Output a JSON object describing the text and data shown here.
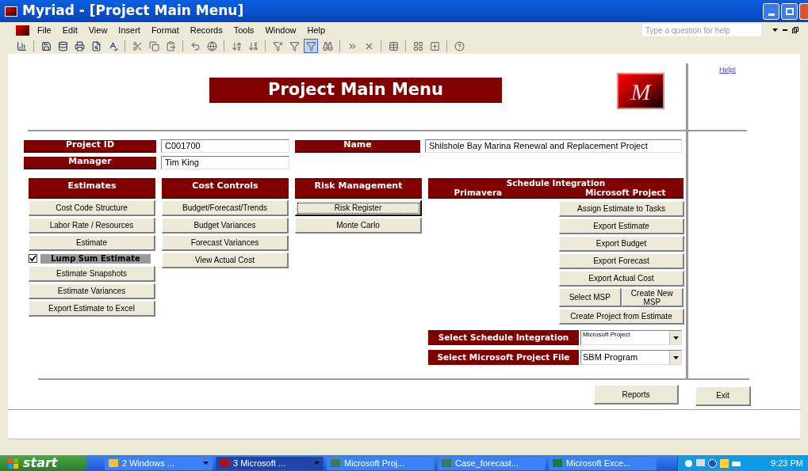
{
  "window": {
    "title": "Myriad - [Project Main Menu]"
  },
  "menu": [
    "File",
    "Edit",
    "View",
    "Insert",
    "Format",
    "Records",
    "Tools",
    "Window",
    "Help"
  ],
  "help_search": {
    "placeholder": "Type a question for help"
  },
  "toolbar": [
    {
      "selected": false
    },
    {
      "selected": false
    },
    {
      "selected": false
    },
    {
      "selected": false
    },
    {
      "selected": false
    },
    {
      "selected": false
    },
    {
      "selected": false
    },
    {
      "selected": false
    },
    {
      "selected": false
    },
    {
      "selected": false
    },
    {
      "selected": false
    },
    {
      "selected": false
    },
    {
      "selected": false
    },
    {
      "selected": false
    },
    {
      "selected": false
    },
    {
      "selected": true
    },
    {
      "selected": false
    },
    {
      "selected": false
    },
    {
      "selected": false
    },
    {
      "selected": false
    },
    {
      "selected": false
    },
    {
      "selected": false
    },
    {
      "selected": false
    }
  ],
  "form": {
    "help_link": "Help!",
    "title": "Project Main Menu",
    "logo": "M",
    "fields": [
      {
        "label": "Project ID",
        "value": "C001700"
      },
      {
        "label": "Name",
        "value": "Shilshole Bay Marina Renewal and Replacement Project"
      },
      {
        "label": "Manager",
        "value": "Tim King"
      }
    ],
    "sections": [
      {
        "title": "Estimates",
        "items": [
          {
            "kind": "button",
            "label": "Cost Code Structure",
            "focused": false
          },
          {
            "kind": "button",
            "label": "Labor Rate / Resources",
            "focused": false
          },
          {
            "kind": "button",
            "label": "Estimate",
            "focused": false
          },
          {
            "kind": "checkbox",
            "label": "Lump Sum Estimate",
            "checked": true
          },
          {
            "kind": "button",
            "label": "Estimate Snapshots",
            "focused": false
          },
          {
            "kind": "button",
            "label": "Estimate Variances",
            "focused": false
          },
          {
            "kind": "button",
            "label": "Export Estimate to Excel",
            "focused": false
          }
        ]
      },
      {
        "title": "Cost Controls",
        "items": [
          {
            "kind": "button",
            "label": "Budget/Forecast/Trends",
            "focused": false
          },
          {
            "kind": "button",
            "label": "Budget Variances",
            "focused": false
          },
          {
            "kind": "button",
            "label": "Forecast Variances",
            "focused": false
          },
          {
            "kind": "button",
            "label": "View Actual Cost",
            "focused": false
          }
        ]
      },
      {
        "title": "Risk Management",
        "items": [
          {
            "kind": "button",
            "label": "Risk Register",
            "focused": true
          },
          {
            "kind": "button",
            "label": "Monte Carlo",
            "focused": false
          }
        ]
      }
    ],
    "schedule": {
      "title": "Schedule Integration",
      "subtitles": [
        "Primavera",
        "Microsoft Project"
      ],
      "buttons": [
        "Assign Estimate to Tasks",
        "Export Estimate",
        "Export Budget",
        "Export Forecast",
        "Export Actual Cost"
      ],
      "pair": [
        "Select MSP",
        "Create New MSP"
      ],
      "last_button": "Create Project from Estimate"
    },
    "selects": [
      {
        "label": "Select Schedule Integration",
        "value": "Microsoft Project"
      },
      {
        "label": "Select Microsoft Project File",
        "value": "SBM Program"
      }
    ],
    "footer_buttons": [
      "Reports",
      "Exit"
    ]
  },
  "taskbar": {
    "start": "start",
    "items": [
      {
        "label": "2 Windows ...",
        "group": true,
        "selected": false
      },
      {
        "label": "3 Microsoft ...",
        "group": true,
        "selected": true
      },
      {
        "label": "Microsoft Proj...",
        "group": false,
        "selected": false
      },
      {
        "label": "Case_forecast...",
        "group": false,
        "selected": false
      },
      {
        "label": "Microsoft Exce...",
        "group": false,
        "selected": false
      }
    ],
    "time": "9:23 PM"
  }
}
